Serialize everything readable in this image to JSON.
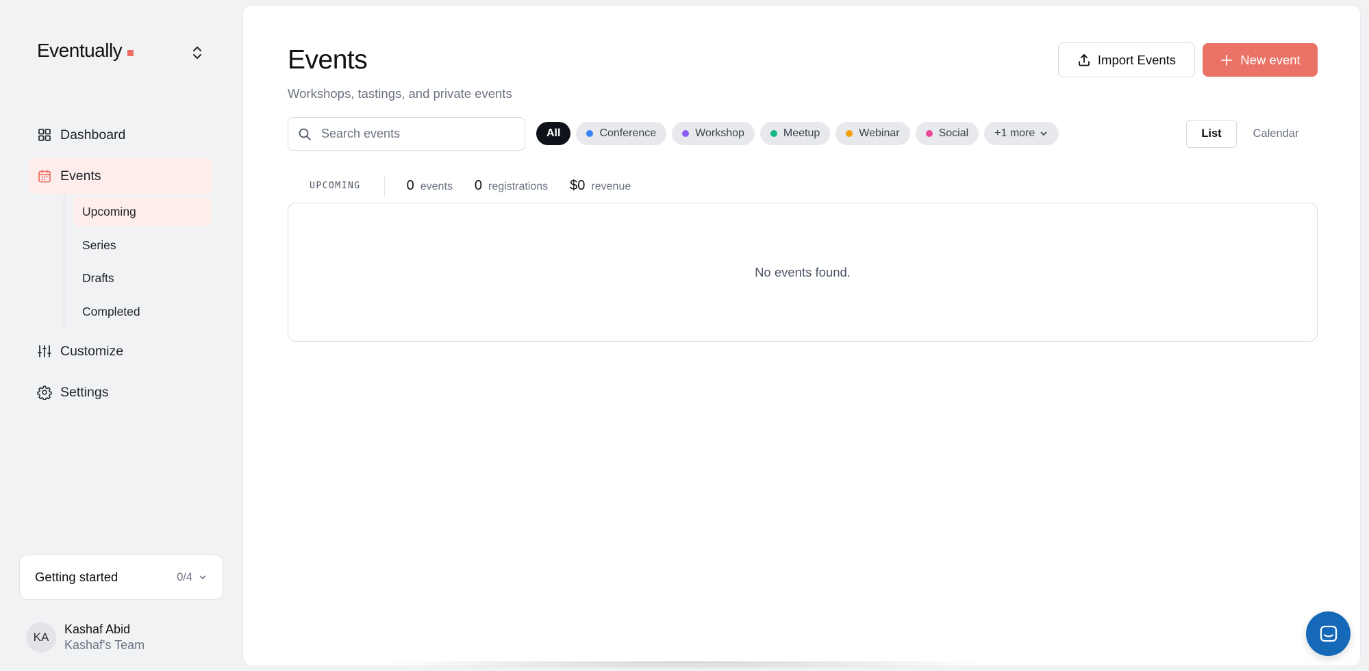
{
  "brand": {
    "name": "Eventually",
    "accent": "#ee6f62"
  },
  "sidebar": {
    "items": [
      {
        "label": "Dashboard",
        "icon": "grid-icon"
      },
      {
        "label": "Events",
        "icon": "calendar-icon",
        "active": true
      },
      {
        "label": "Customize",
        "icon": "sliders-icon"
      },
      {
        "label": "Settings",
        "icon": "gear-icon"
      }
    ],
    "event_subitems": [
      {
        "label": "Upcoming",
        "active": true
      },
      {
        "label": "Series"
      },
      {
        "label": "Drafts"
      },
      {
        "label": "Completed"
      }
    ],
    "getting_started": {
      "label": "Getting started",
      "progress": "0/4"
    },
    "user": {
      "initials": "KA",
      "name": "Kashaf Abid",
      "team": "Kashaf's Team"
    }
  },
  "header": {
    "title": "Events",
    "subtitle": "Workshops, tastings, and private events",
    "import_label": "Import Events",
    "new_label": "New event"
  },
  "search": {
    "placeholder": "Search events",
    "value": ""
  },
  "filters": [
    {
      "label": "All",
      "active": true
    },
    {
      "label": "Conference",
      "color": "#3b82f6"
    },
    {
      "label": "Workshop",
      "color": "#8b5cf6"
    },
    {
      "label": "Meetup",
      "color": "#10b981"
    },
    {
      "label": "Webinar",
      "color": "#f59e0b"
    },
    {
      "label": "Social",
      "color": "#ec4899"
    },
    {
      "label": "+1 more",
      "dropdown": true
    }
  ],
  "view_toggle": {
    "list": "List",
    "calendar": "Calendar",
    "selected": "List"
  },
  "stats": {
    "section": "UPCOMING",
    "events_value": "0",
    "events_label": "events",
    "registrations_value": "0",
    "registrations_label": "registrations",
    "revenue_value": "$0",
    "revenue_label": "revenue"
  },
  "empty_state": {
    "message": "No events found."
  },
  "colors": {
    "primary": "#ea7266",
    "active_bg": "#fdeeeb",
    "chat": "#1569b8"
  }
}
